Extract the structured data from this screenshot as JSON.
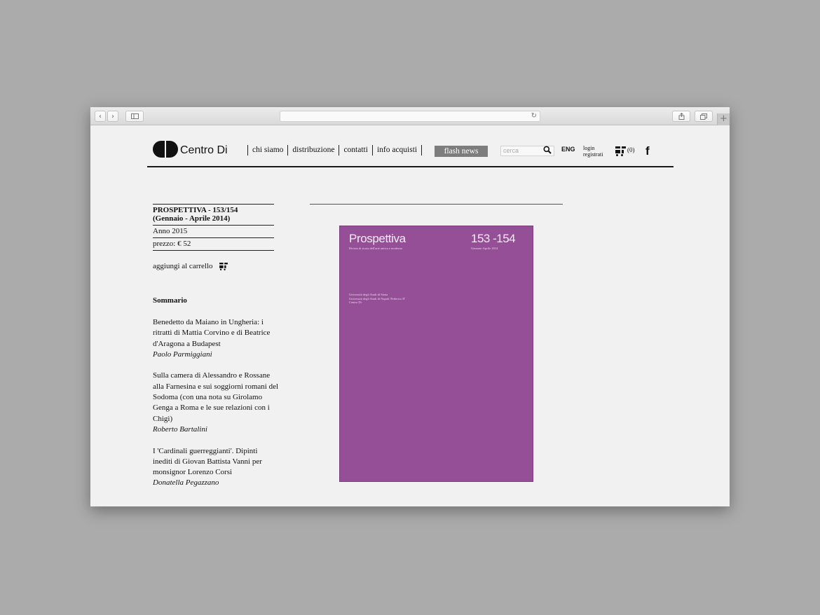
{
  "browser": {
    "nav_back": "‹",
    "nav_forward": "›",
    "reload": "↻",
    "new_tab": "+"
  },
  "header": {
    "brand": "Centro Di",
    "nav": [
      "chi siamo",
      "distribuzione",
      "contatti",
      "info acquisti"
    ],
    "flash_news": "flash news",
    "search_placeholder": "cerca",
    "language": "ENG",
    "login": "login",
    "register": "registrati",
    "cart_count": "(0)",
    "facebook": "f"
  },
  "product": {
    "title_line1": "PROSPETTIVA - 153/154",
    "title_line2": "(Gennaio - Aprile 2014)",
    "year": "Anno 2015",
    "price": "prezzo: € 52",
    "add_to_cart": "aggiungi al carrello"
  },
  "summary": {
    "heading": "Sommario",
    "items": [
      {
        "text": "Benedetto da Maiano in Ungheria: i ritratti di Mattia Corvino e di Beatrice d'Aragona a Budapest",
        "author": "Paolo Parmiggiani"
      },
      {
        "text": "Sulla camera di Alessandro e Rossane alla Farnesina e sui soggiorni romani del Sodoma (con una nota su Girolamo Genga a Roma e le sue relazioni con i Chigi)",
        "author": "Roberto Bartalini"
      },
      {
        "text": "I 'Cardinali guerreggianti'. Dipinti inediti di Giovan Battista Vanni per monsignor Lorenzo Corsi",
        "author": "Donatella Pegazzano"
      }
    ]
  },
  "cover": {
    "title": "Prospettiva",
    "issue": "153 -154",
    "subtitle": "Rivista di storia dell'arte antica e moderna",
    "date": "Gennaio-Aprile 2014",
    "publisher_lines": [
      "Università degli Studi di Siena",
      "Università degli Studi di Napoli 'Federico II'",
      "Centro Di"
    ]
  },
  "colors": {
    "cover": "#944f96",
    "flash_news_bg": "#7d7d7d",
    "page_bg": "#f1f1f1",
    "desktop_bg": "#ababab"
  }
}
